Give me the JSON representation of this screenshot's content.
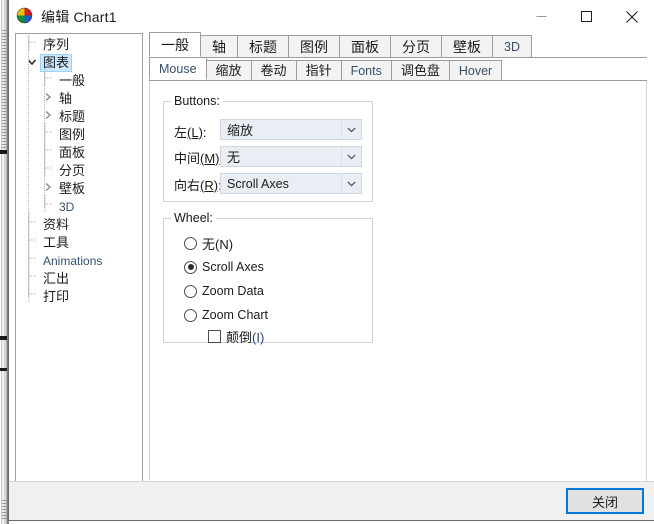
{
  "window": {
    "title": "编辑 Chart1",
    "icon": "chart-pie-icon",
    "controls": {
      "minimize": "–",
      "maximize": "□",
      "close": "✕"
    }
  },
  "tree": {
    "items": [
      {
        "label": "序列",
        "depth": 0,
        "chevron": "none",
        "selected": false,
        "english": false
      },
      {
        "label": "图表",
        "depth": 0,
        "chevron": "expanded",
        "selected": true,
        "english": false
      },
      {
        "label": "一般",
        "depth": 1,
        "chevron": "none",
        "selected": false,
        "english": false
      },
      {
        "label": "轴",
        "depth": 1,
        "chevron": "collapsed",
        "selected": false,
        "english": false
      },
      {
        "label": "标题",
        "depth": 1,
        "chevron": "collapsed",
        "selected": false,
        "english": false
      },
      {
        "label": "图例",
        "depth": 1,
        "chevron": "none",
        "selected": false,
        "english": false
      },
      {
        "label": "面板",
        "depth": 1,
        "chevron": "none",
        "selected": false,
        "english": false
      },
      {
        "label": "分页",
        "depth": 1,
        "chevron": "none",
        "selected": false,
        "english": false
      },
      {
        "label": "壁板",
        "depth": 1,
        "chevron": "collapsed",
        "selected": false,
        "english": false
      },
      {
        "label": "3D",
        "depth": 1,
        "chevron": "none",
        "selected": false,
        "english": true
      },
      {
        "label": "资料",
        "depth": 0,
        "chevron": "none",
        "selected": false,
        "english": false
      },
      {
        "label": "工具",
        "depth": 0,
        "chevron": "none",
        "selected": false,
        "english": false
      },
      {
        "label": "Animations",
        "depth": 0,
        "chevron": "none",
        "selected": false,
        "english": true
      },
      {
        "label": "汇出",
        "depth": 0,
        "chevron": "none",
        "selected": false,
        "english": false
      },
      {
        "label": "打印",
        "depth": 0,
        "chevron": "none",
        "selected": false,
        "english": false
      }
    ]
  },
  "main_tabs": {
    "active_index": 0,
    "items": [
      {
        "label": "一般",
        "english": false
      },
      {
        "label": "轴",
        "english": false
      },
      {
        "label": "标题",
        "english": false
      },
      {
        "label": "图例",
        "english": false
      },
      {
        "label": "面板",
        "english": false
      },
      {
        "label": "分页",
        "english": false
      },
      {
        "label": "壁板",
        "english": false
      },
      {
        "label": "3D",
        "english": true
      }
    ]
  },
  "sub_tabs": {
    "active_index": 0,
    "items": [
      {
        "label": "Mouse",
        "english": true
      },
      {
        "label": "缩放",
        "english": false
      },
      {
        "label": "卷动",
        "english": false
      },
      {
        "label": "指针",
        "english": false
      },
      {
        "label": "Fonts",
        "english": true
      },
      {
        "label": "调色盘",
        "english": false
      },
      {
        "label": "Hover",
        "english": true
      }
    ]
  },
  "buttons_group": {
    "legend": "Buttons:",
    "rows": [
      {
        "label_main": "左",
        "label_acc": "(L)",
        "label_tail": ":",
        "value": "缩放",
        "value_english": false
      },
      {
        "label_main": "中间",
        "label_acc": "(M)",
        "label_tail": "",
        "value": "无",
        "value_english": false
      },
      {
        "label_main": "向右",
        "label_acc": "(R)",
        "label_tail": ":",
        "value": "Scroll Axes",
        "value_english": true
      }
    ]
  },
  "wheel_group": {
    "legend": "Wheel:",
    "selected_index": 1,
    "radios": [
      {
        "label": "无(N)",
        "english": false
      },
      {
        "label": "Scroll Axes",
        "english": true
      },
      {
        "label": "Zoom Data",
        "english": true
      },
      {
        "label": "Zoom Chart",
        "english": true
      }
    ],
    "checkbox": {
      "label_main": "颠倒",
      "label_acc": "(I)",
      "checked": false
    }
  },
  "footer": {
    "close_label": "关闭"
  },
  "colors": {
    "accent": "#0078d7",
    "selection": "#cde8ff",
    "combo_fill": "#e9eef4",
    "footer_bg": "#f0f0f0",
    "tab_inactive": "#f3f3f3"
  }
}
